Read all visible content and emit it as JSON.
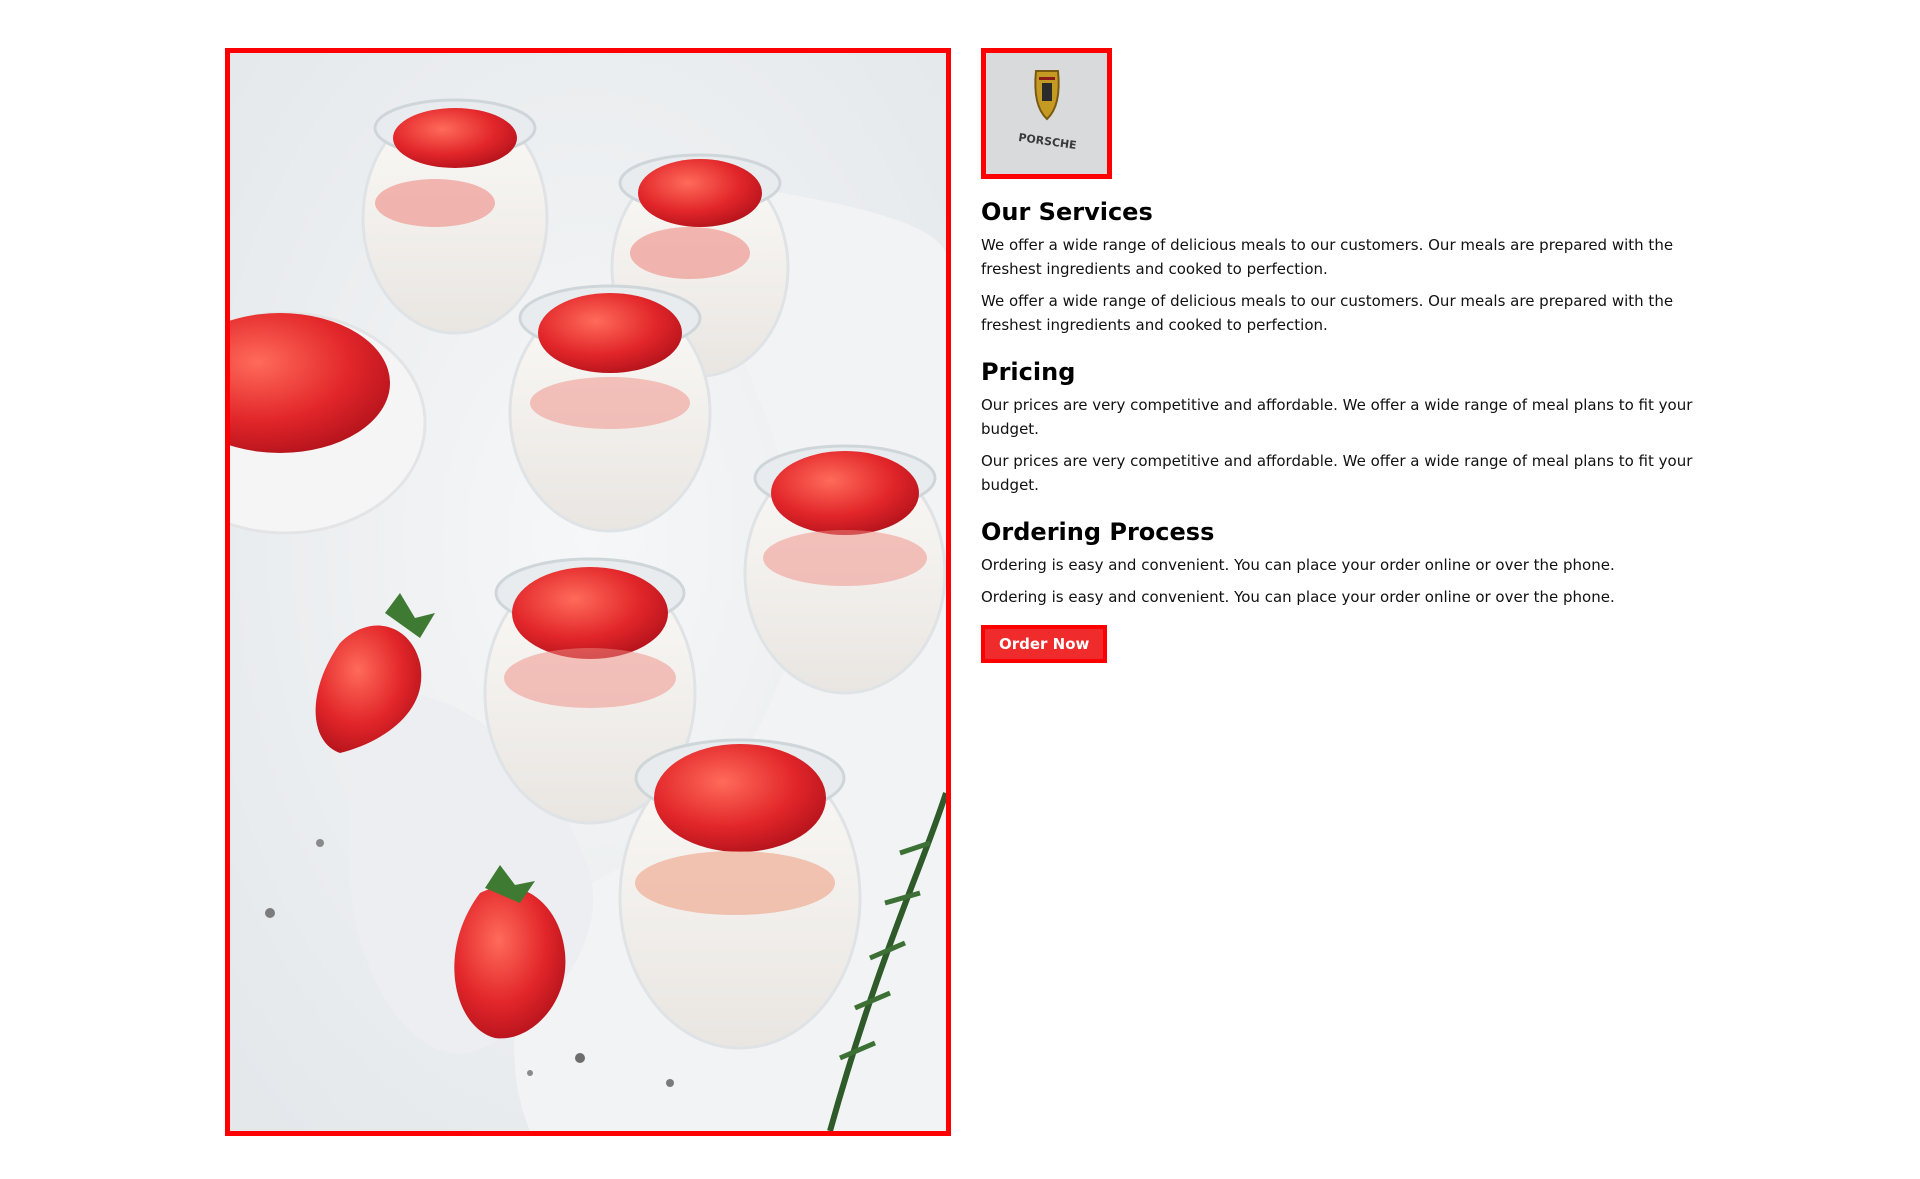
{
  "images": {
    "hero": "strawberry-panna-cotta-jars-photo",
    "logo": "porsche-crest-logo"
  },
  "logo_text": "PORSCHE",
  "sections": [
    {
      "title": "Our Services",
      "paragraphs": [
        "We offer a wide range of delicious meals to our customers. Our meals are prepared with the freshest ingredients and cooked to perfection.",
        "We offer a wide range of delicious meals to our customers. Our meals are prepared with the freshest ingredients and cooked to perfection."
      ]
    },
    {
      "title": "Pricing",
      "paragraphs": [
        "Our prices are very competitive and affordable. We offer a wide range of meal plans to fit your budget.",
        "Our prices are very competitive and affordable. We offer a wide range of meal plans to fit your budget."
      ]
    },
    {
      "title": "Ordering Process",
      "paragraphs": [
        "Ordering is easy and convenient. You can place your order online or over the phone.",
        "Ordering is easy and convenient. You can place your order online or over the phone."
      ]
    }
  ],
  "cta": {
    "label": "Order Now"
  },
  "colors": {
    "frame_border": "#ff0000",
    "button_bg": "#ef2b2b",
    "button_text": "#ffffff",
    "text": "#111111"
  }
}
